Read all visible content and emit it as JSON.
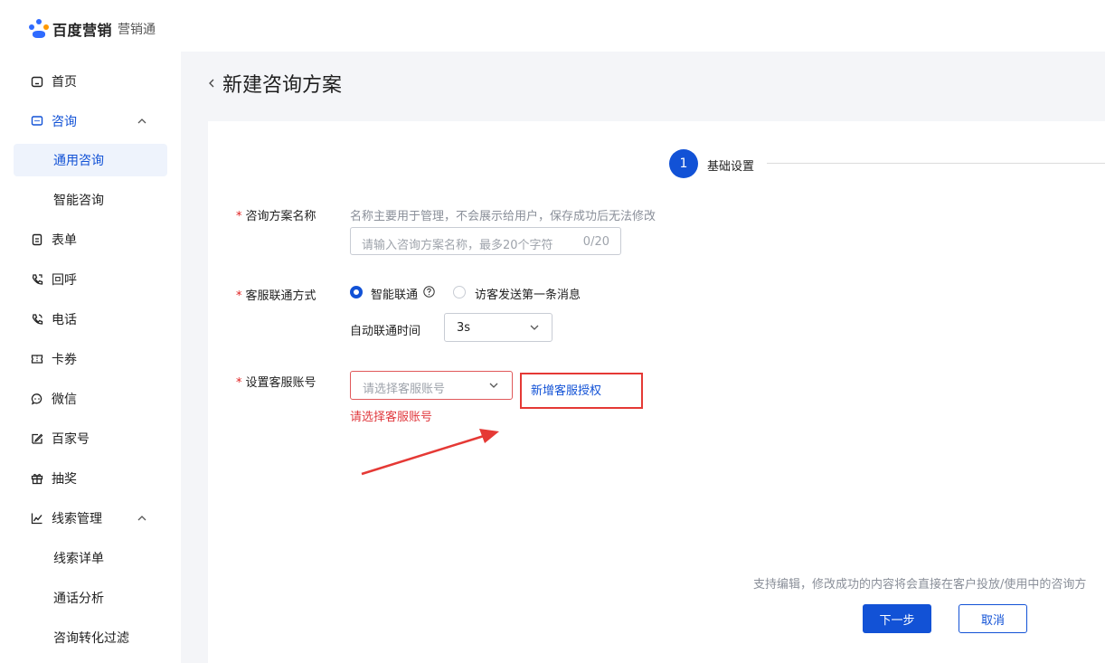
{
  "brand": {
    "name": "百度营销",
    "product": "营销通",
    "colors": {
      "primary": "#1252d6",
      "error": "#e0393e"
    }
  },
  "sidebar": {
    "items": [
      {
        "label": "首页",
        "icon": "home-icon"
      },
      {
        "label": "咨询",
        "icon": "chat-icon",
        "expanded": true
      },
      {
        "label": "通用咨询",
        "sub": true,
        "active": true
      },
      {
        "label": "智能咨询",
        "sub": true
      },
      {
        "label": "表单",
        "icon": "form-icon"
      },
      {
        "label": "回呼",
        "icon": "phone-callback-icon"
      },
      {
        "label": "电话",
        "icon": "phone-icon"
      },
      {
        "label": "卡券",
        "icon": "ticket-icon"
      },
      {
        "label": "微信",
        "icon": "wechat-icon"
      },
      {
        "label": "百家号",
        "icon": "edit-icon"
      },
      {
        "label": "抽奖",
        "icon": "gift-icon"
      },
      {
        "label": "线索管理",
        "icon": "chart-icon",
        "expanded": true
      },
      {
        "label": "线索详单",
        "sub": true
      },
      {
        "label": "通话分析",
        "sub": true
      },
      {
        "label": "咨询转化过滤",
        "sub": true
      }
    ]
  },
  "header": {
    "title": "新建咨询方案"
  },
  "steps": [
    {
      "number": "1",
      "label": "基础设置",
      "active": true
    }
  ],
  "form": {
    "name_field": {
      "label": "咨询方案名称",
      "hint": "名称主要用于管理，不会展示给用户，保存成功后无法修改",
      "placeholder": "请输入咨询方案名称，最多20个字符",
      "counter": "0/20"
    },
    "contact_method": {
      "label": "客服联通方式",
      "options": [
        {
          "label": "智能联通",
          "selected": true
        },
        {
          "label": "访客发送第一条消息",
          "selected": false
        }
      ],
      "auto_time_label": "自动联通时间",
      "auto_time_value": "3s"
    },
    "account": {
      "label": "设置客服账号",
      "placeholder": "请选择客服账号",
      "error": "请选择客服账号",
      "add_link": "新增客服授权"
    }
  },
  "footer": {
    "note": "支持编辑，修改成功的内容将会直接在客户投放/使用中的咨询方",
    "next_label": "下一步",
    "cancel_label": "取消"
  }
}
